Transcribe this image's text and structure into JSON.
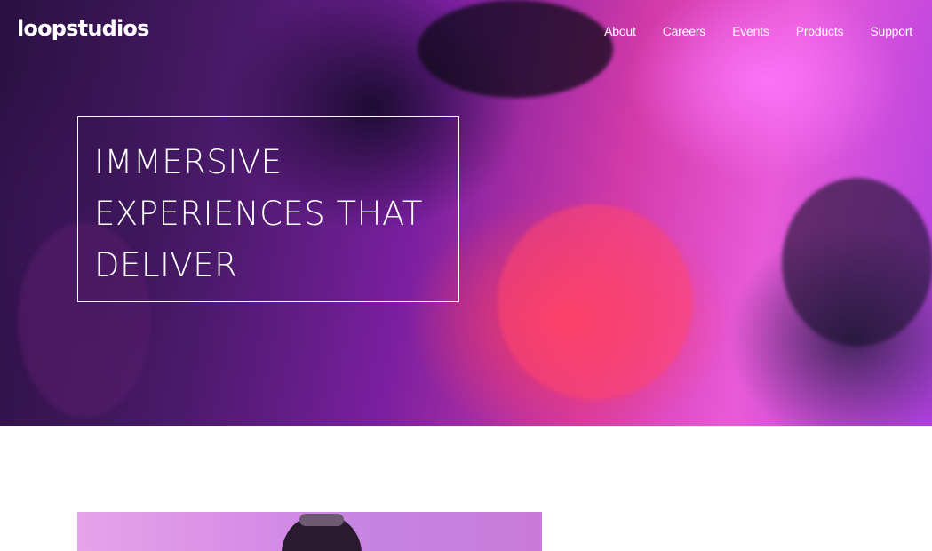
{
  "header": {
    "logo": "loopstudios",
    "nav": [
      "About",
      "Careers",
      "Events",
      "Products",
      "Support"
    ]
  },
  "hero": {
    "headline_lines": [
      "IMMERSIVE",
      "EXPERIENCES THAT",
      "DELIVER"
    ]
  },
  "colors": {
    "text_on_hero": "#ffffff",
    "page_background": "#ffffff",
    "hero_accent_magenta": "#e85ad8",
    "hero_accent_red": "#ff3c5a"
  }
}
